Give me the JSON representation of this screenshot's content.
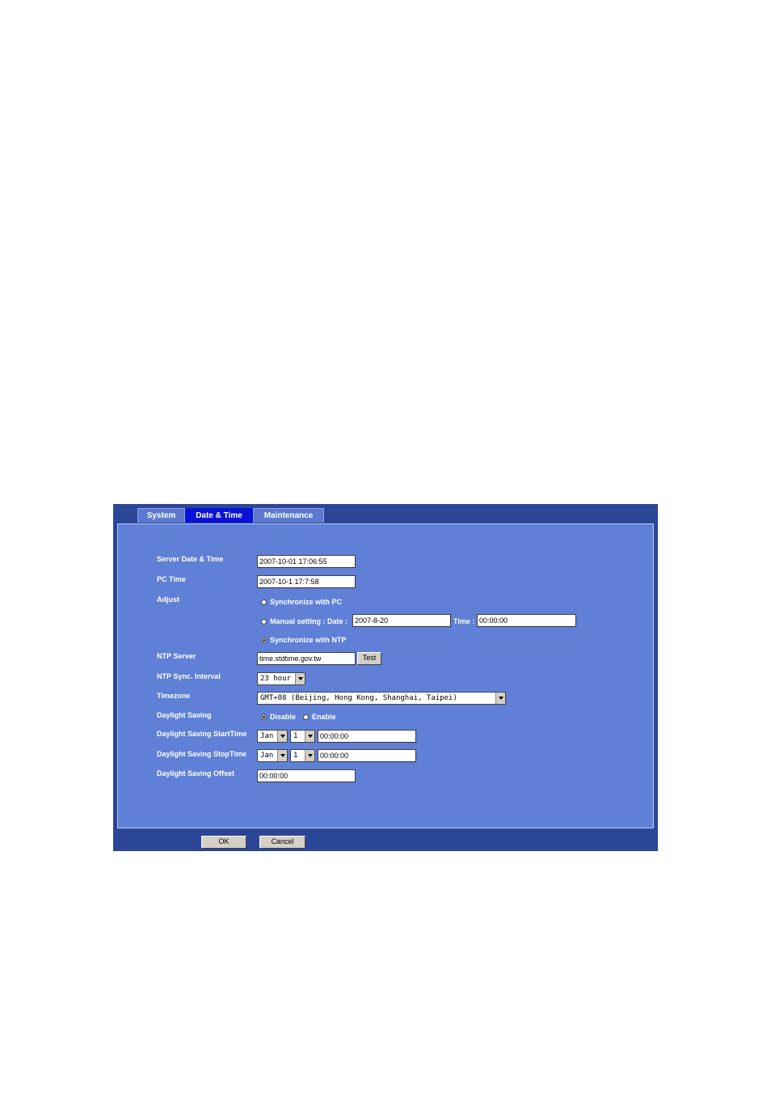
{
  "tabs": {
    "system": "System",
    "date_time": "Date & Time",
    "maintenance": "Maintenance"
  },
  "labels": {
    "server_date_time": "Server Date & Time",
    "pc_time": "PC Time",
    "adjust": "Adjust",
    "ntp_server": "NTP Server",
    "ntp_interval": "NTP Sync. Interval",
    "timezone": "Timezone",
    "daylight_saving": "Daylight Saving",
    "ds_start": "Daylight Saving StartTime",
    "ds_stop": "Daylight Saving StopTime",
    "ds_offset": "Daylight Saving Offset"
  },
  "values": {
    "server_date_time": "2007-10-01 17:06:55",
    "pc_time": "2007-10-1 17:7:58",
    "manual_date": "2007-8-20",
    "manual_time": "00:00:00",
    "ntp_server": "time.stdtime.gov.tw",
    "ntp_interval": "23 hour",
    "timezone": "GMT+08 (Beijing, Hong Kong, Shanghai, Taipei)",
    "ds_start_month": "Jan",
    "ds_start_day": "1",
    "ds_start_time": "00:00:00",
    "ds_stop_month": "Jan",
    "ds_stop_day": "1",
    "ds_stop_time": "00:00:00",
    "ds_offset": "00:00:00"
  },
  "adjust_options": {
    "sync_pc": "Synchronize with PC",
    "manual_date_label": "Manual setting : Date :",
    "manual_time_label": "Time :",
    "sync_ntp": "Synchronize with NTP",
    "selected": "sync_ntp"
  },
  "daylight_options": {
    "disable": "Disable",
    "enable": "Enable",
    "selected": "disable"
  },
  "buttons": {
    "test": "Test",
    "ok": "OK",
    "cancel": "Cancel"
  },
  "colors": {
    "panel_bg": "#2b4597",
    "content_bg": "#5f80d6",
    "active_tab": "#0a12d8",
    "inactive_tab": "#5b79d1"
  }
}
